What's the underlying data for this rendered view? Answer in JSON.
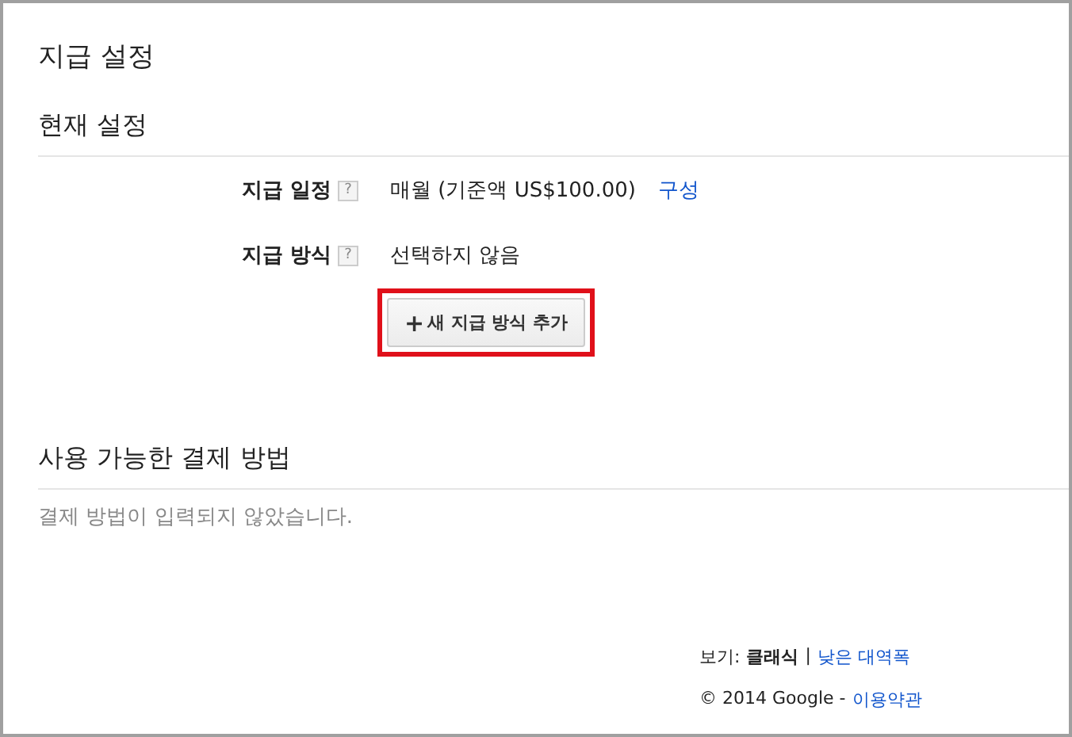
{
  "page_title": "지급 설정",
  "current_settings": {
    "heading": "현재 설정",
    "rows": [
      {
        "label": "지급 일정",
        "help": "?",
        "value": "매월 (기준액 US$100.00)",
        "link": "구성"
      },
      {
        "label": "지급 방식",
        "help": "?",
        "value": "선택하지 않음"
      }
    ],
    "add_button": {
      "icon": "+",
      "label": "새 지급 방식 추가",
      "highlighted": true
    }
  },
  "available_methods": {
    "heading": "사용 가능한 결제 방법",
    "message": "결제 방법이 입력되지 않았습니다."
  },
  "footer": {
    "view_label": "보기:",
    "view_options": [
      {
        "label": "클래식",
        "selected": true
      },
      {
        "label": "낮은 대역폭",
        "selected": false
      }
    ],
    "separator": "|",
    "copyright": "© 2014 Google -",
    "terms_link": "이용약관"
  }
}
